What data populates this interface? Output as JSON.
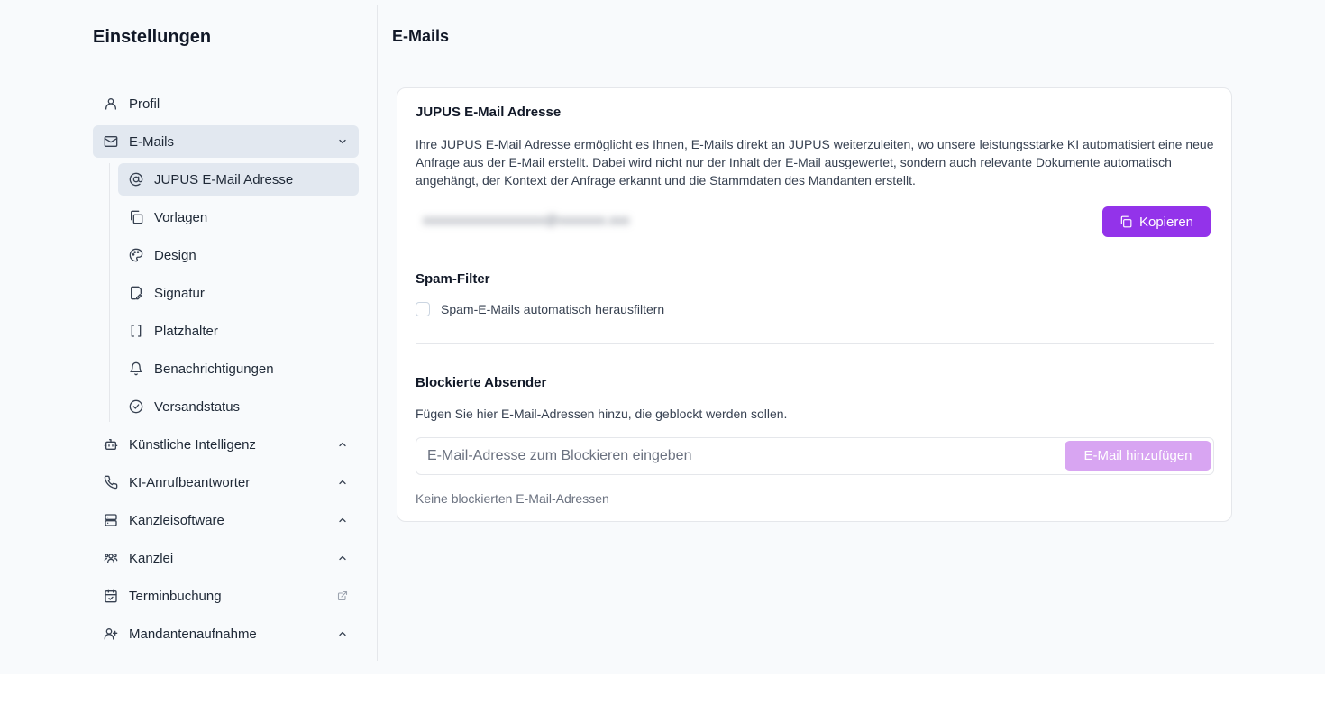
{
  "sidebar": {
    "title": "Einstellungen",
    "items": [
      {
        "label": "Profil",
        "icon": "user-icon"
      },
      {
        "label": "E-Mails",
        "icon": "mail-icon",
        "expanded": true
      },
      {
        "label": "Künstliche Intelligenz",
        "icon": "bot-icon"
      },
      {
        "label": "KI-Anrufbeantworter",
        "icon": "phone-icon"
      },
      {
        "label": "Kanzleisoftware",
        "icon": "server-icon"
      },
      {
        "label": "Kanzlei",
        "icon": "users-icon"
      },
      {
        "label": "Terminbuchung",
        "icon": "calendar-check-icon"
      },
      {
        "label": "Mandantenaufnahme",
        "icon": "user-plus-icon"
      }
    ],
    "email_subitems": [
      {
        "label": "JUPUS E-Mail Adresse",
        "icon": "at-sign-icon"
      },
      {
        "label": "Vorlagen",
        "icon": "copy-icon"
      },
      {
        "label": "Design",
        "icon": "palette-icon"
      },
      {
        "label": "Signatur",
        "icon": "file-signature-icon"
      },
      {
        "label": "Platzhalter",
        "icon": "brackets-icon"
      },
      {
        "label": "Benachrichtigungen",
        "icon": "bell-icon"
      },
      {
        "label": "Versandstatus",
        "icon": "check-circle-icon"
      }
    ]
  },
  "main": {
    "title": "E-Mails",
    "card": {
      "title": "JUPUS E-Mail Adresse",
      "description": "Ihre JUPUS E-Mail Adresse ermöglicht es Ihnen, E-Mails direkt an JUPUS weiterzuleiten, wo unsere leistungsstarke KI automatisiert eine neue Anfrage aus der E-Mail erstellt. Dabei wird nicht nur der Inhalt der E-Mail ausgewertet, sondern auch relevante Dokumente automatisch angehängt, der Kontext der Anfrage erkannt und die Stammdaten des Mandanten erstellt.",
      "copy_button": "Kopieren",
      "spam_title": "Spam-Filter",
      "spam_checkbox_label": "Spam-E-Mails automatisch herausfiltern",
      "blocked_title": "Blockierte Absender",
      "blocked_description": "Fügen Sie hier E-Mail-Adressen hinzu, die geblockt werden sollen.",
      "input_placeholder": "E-Mail-Adresse zum Blockieren eingeben",
      "add_button": "E-Mail hinzufügen",
      "empty_text": "Keine blockierten E-Mail-Adressen"
    }
  },
  "colors": {
    "accent": "#9333ea",
    "accent_disabled": "#d8a5f2",
    "active_bg": "#e2e8f0"
  }
}
